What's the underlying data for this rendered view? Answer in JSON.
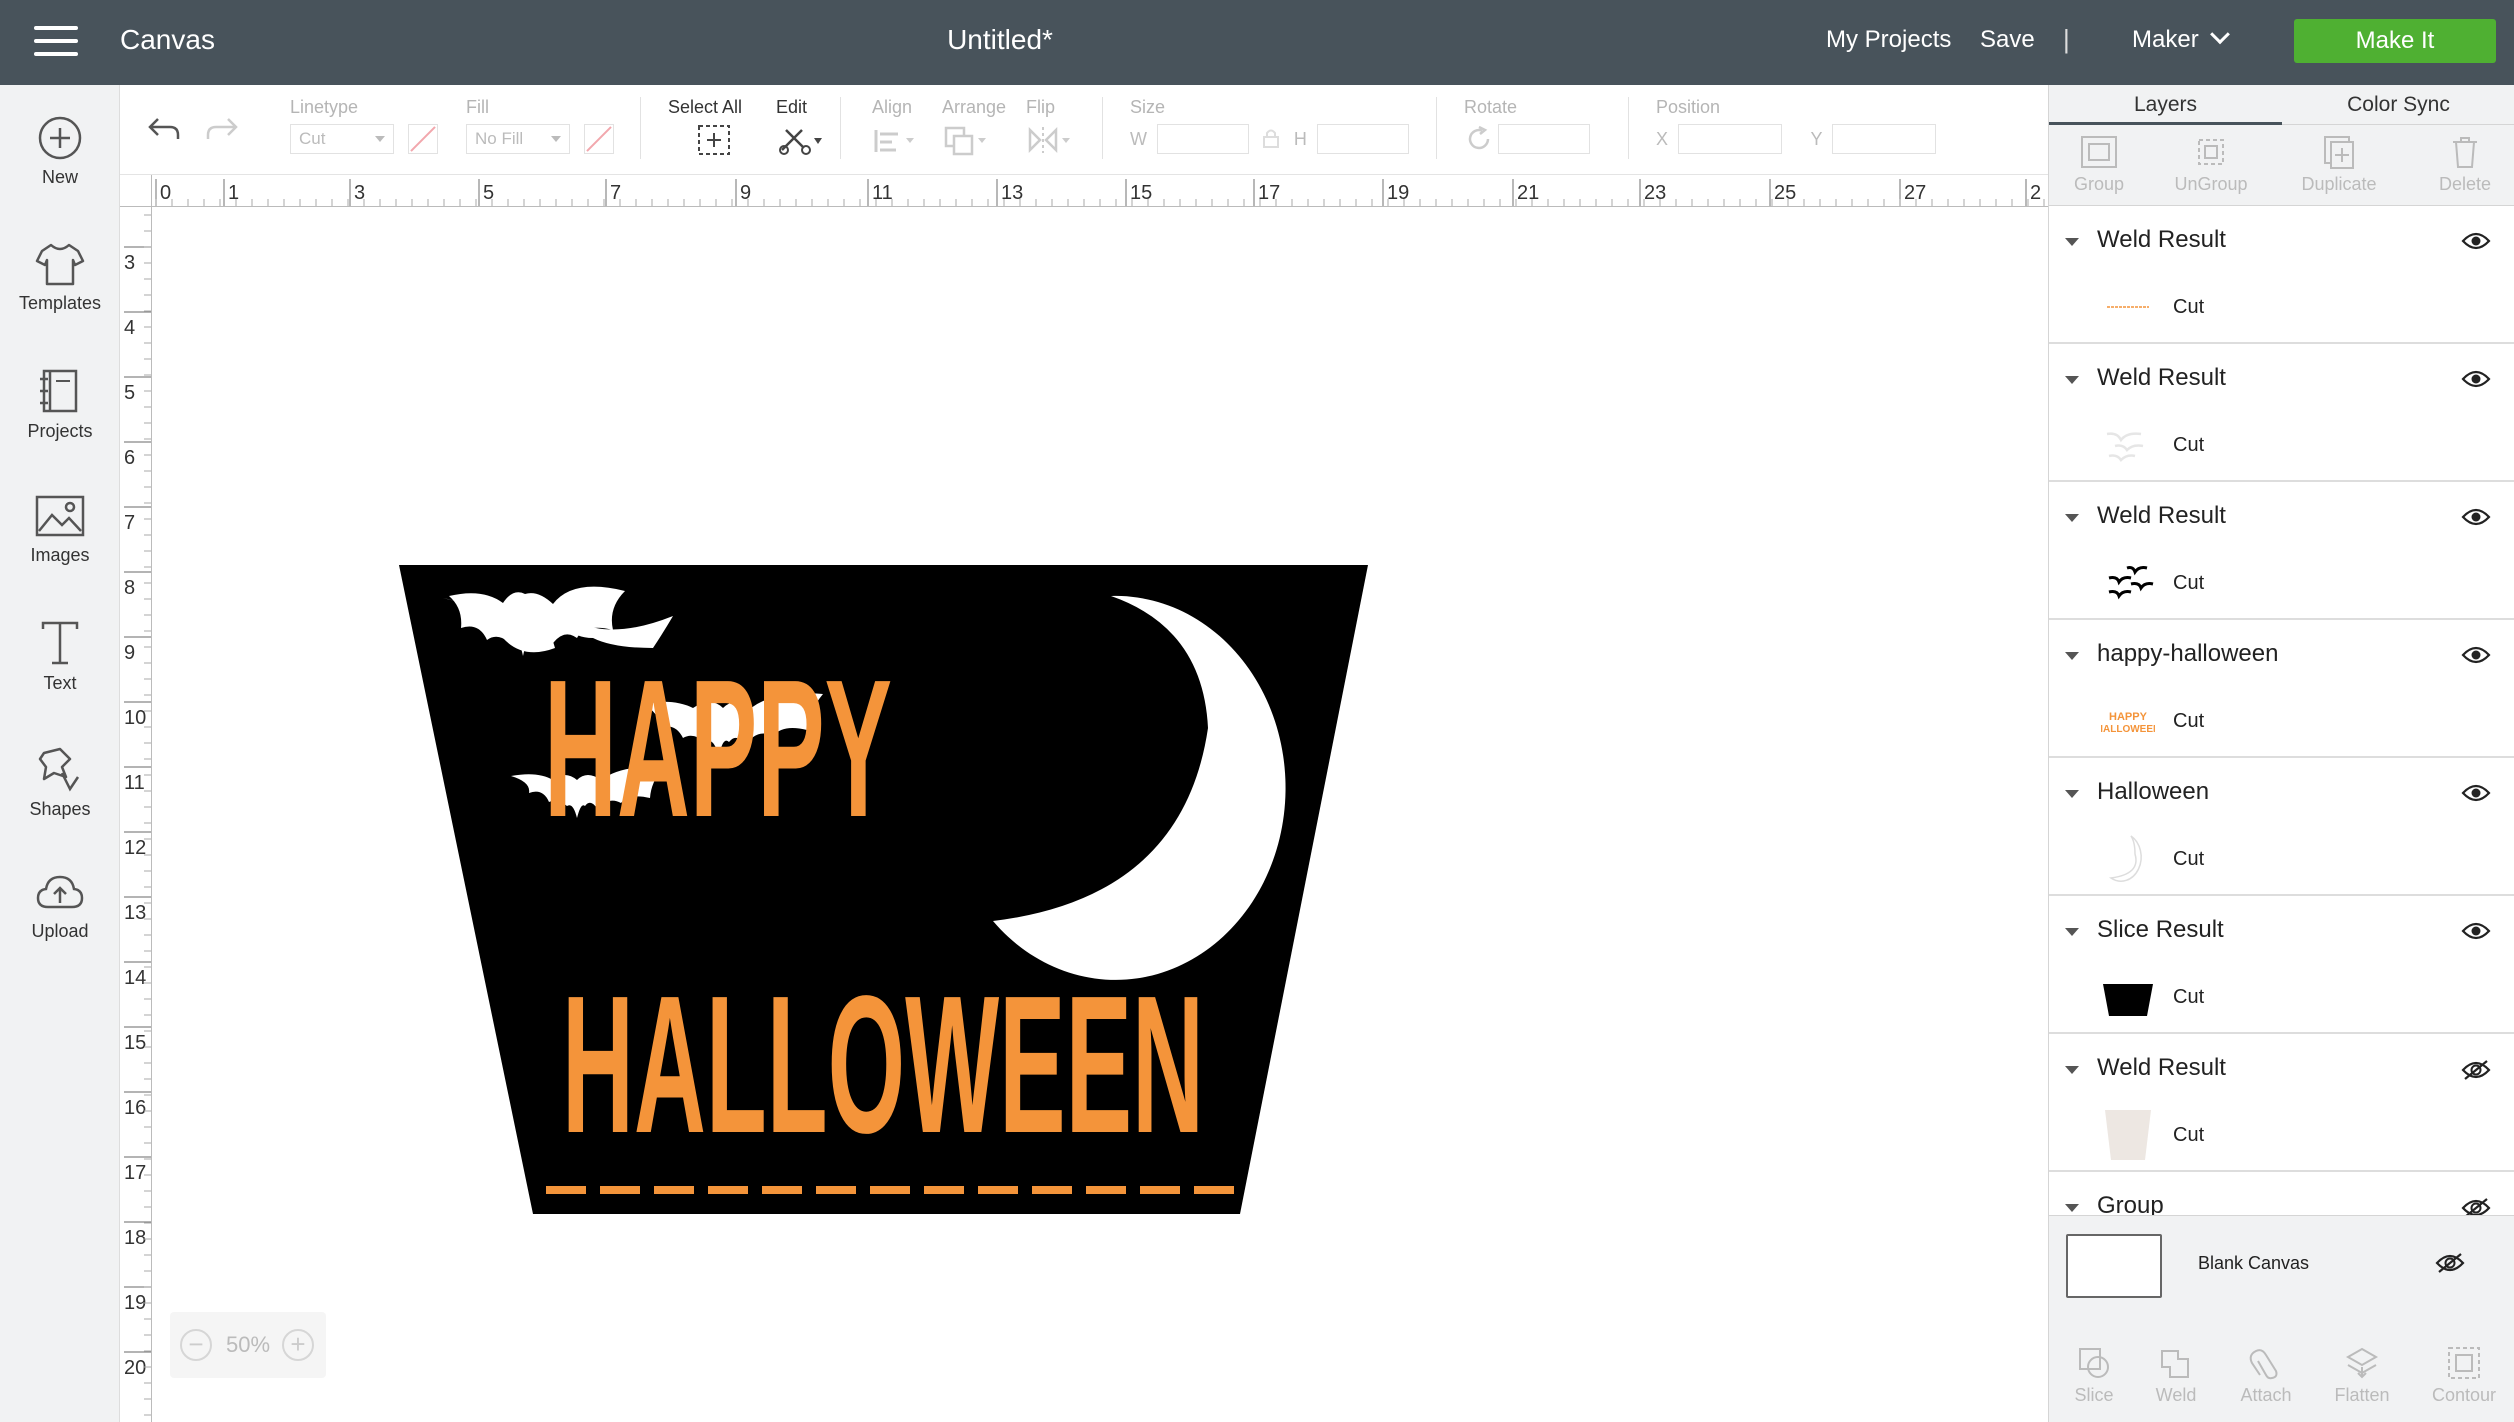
{
  "topbar": {
    "app_title": "Canvas",
    "doc_title": "Untitled*",
    "my_projects": "My Projects",
    "save": "Save",
    "separator": "|",
    "machine": "Maker",
    "make_it": "Make It",
    "make_it_color": "#4fb032"
  },
  "leftbar": {
    "items": [
      {
        "label": "New",
        "icon": "plus-circle-icon"
      },
      {
        "label": "Templates",
        "icon": "tshirt-icon"
      },
      {
        "label": "Projects",
        "icon": "book-icon"
      },
      {
        "label": "Images",
        "icon": "image-icon"
      },
      {
        "label": "Text",
        "icon": "text-icon"
      },
      {
        "label": "Shapes",
        "icon": "shapes-icon"
      },
      {
        "label": "Upload",
        "icon": "cloud-upload-icon"
      }
    ]
  },
  "toolbar": {
    "linetype_label": "Linetype",
    "linetype_value": "Cut",
    "fill_label": "Fill",
    "fill_value": "No Fill",
    "select_all_label": "Select All",
    "edit_label": "Edit",
    "align_label": "Align",
    "arrange_label": "Arrange",
    "flip_label": "Flip",
    "size_label": "Size",
    "w_label": "W",
    "h_label": "H",
    "rotate_label": "Rotate",
    "position_label": "Position",
    "x_label": "X",
    "y_label": "Y"
  },
  "rulers": {
    "top": [
      "0",
      "1",
      "3",
      "5",
      "7",
      "9",
      "11",
      "13",
      "15",
      "17",
      "19",
      "21",
      "23",
      "25",
      "27",
      "2"
    ],
    "left": [
      "3",
      "4",
      "5",
      "6",
      "7",
      "8",
      "9",
      "10",
      "11",
      "12",
      "13",
      "14",
      "15",
      "16",
      "17",
      "18",
      "19",
      "20"
    ]
  },
  "design": {
    "line1": "HAPPY",
    "line2": "HALLOWEEN",
    "text_color": "#f4943a",
    "bg_color": "#000000"
  },
  "zoom": {
    "value": "50%",
    "minus": "−",
    "plus": "+"
  },
  "rightpanel": {
    "tabs": [
      "Layers",
      "Color Sync"
    ],
    "actions": [
      "Group",
      "UnGroup",
      "Duplicate",
      "Delete"
    ],
    "layers": [
      {
        "name": "Weld Result",
        "type": "Cut",
        "visible": true,
        "thumb": "orange-line"
      },
      {
        "name": "Weld Result",
        "type": "Cut",
        "visible": true,
        "thumb": "light-bats"
      },
      {
        "name": "Weld Result",
        "type": "Cut",
        "visible": true,
        "thumb": "black-bats"
      },
      {
        "name": "happy-halloween",
        "type": "Cut",
        "visible": true,
        "thumb": "happy-halloween-text"
      },
      {
        "name": "Halloween",
        "type": "Cut",
        "visible": true,
        "thumb": "moon"
      },
      {
        "name": "Slice Result",
        "type": "Cut",
        "visible": true,
        "thumb": "black-trapezoid"
      },
      {
        "name": "Weld Result",
        "type": "Cut",
        "visible": false,
        "thumb": "beige-trapezoid"
      },
      {
        "name": "Group",
        "type": "",
        "visible": false,
        "thumb": ""
      }
    ],
    "thumb_text": {
      "line1": "HAPPY",
      "line2": "HALLOWEEN"
    },
    "blank_canvas": "Blank Canvas",
    "bottom_actions": [
      "Slice",
      "Weld",
      "Attach",
      "Flatten",
      "Contour"
    ]
  }
}
